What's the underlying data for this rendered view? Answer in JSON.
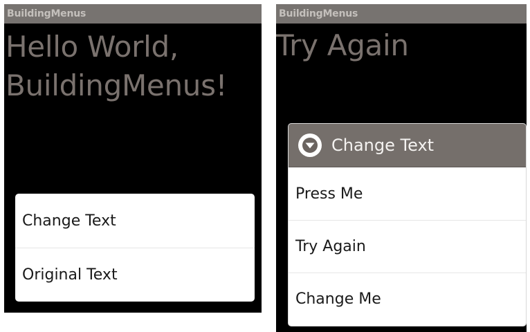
{
  "left_screen": {
    "app_title": "BuildingMenus",
    "main_text_line1": "Hello World,",
    "main_text_line2": "BuildingMenus!",
    "context_menu": {
      "items": [
        {
          "label": "Change Text"
        },
        {
          "label": "Original Text"
        }
      ]
    }
  },
  "right_screen": {
    "app_title": "BuildingMenus",
    "main_text": "Try Again",
    "submenu": {
      "header": {
        "label": "Change Text",
        "icon": "chevron-down-circle-icon"
      },
      "items": [
        {
          "label": "Press Me"
        },
        {
          "label": "Try Again"
        },
        {
          "label": "Change Me"
        }
      ]
    }
  },
  "colors": {
    "titlebar_bg": "#777370",
    "titlebar_text": "#c4c0bc",
    "screen_bg": "#000000",
    "main_text": "#7a726e",
    "menu_bg": "#ffffff",
    "menu_header_bg": "#756f6b",
    "menu_text": "#1a1a1a"
  }
}
